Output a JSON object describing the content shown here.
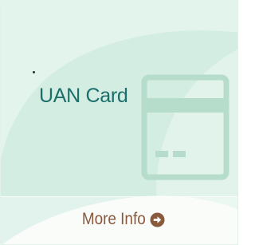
{
  "tile": {
    "title": "UAN Card",
    "icon": "credit-card-icon",
    "more_info_label": "More Info",
    "more_info_icon": "circle-arrow-right-icon"
  },
  "colors": {
    "background": "#d3ede3",
    "title": "#1b6e6a",
    "card_icon": "#b6dccb",
    "more_info": "#8a5a3e"
  }
}
